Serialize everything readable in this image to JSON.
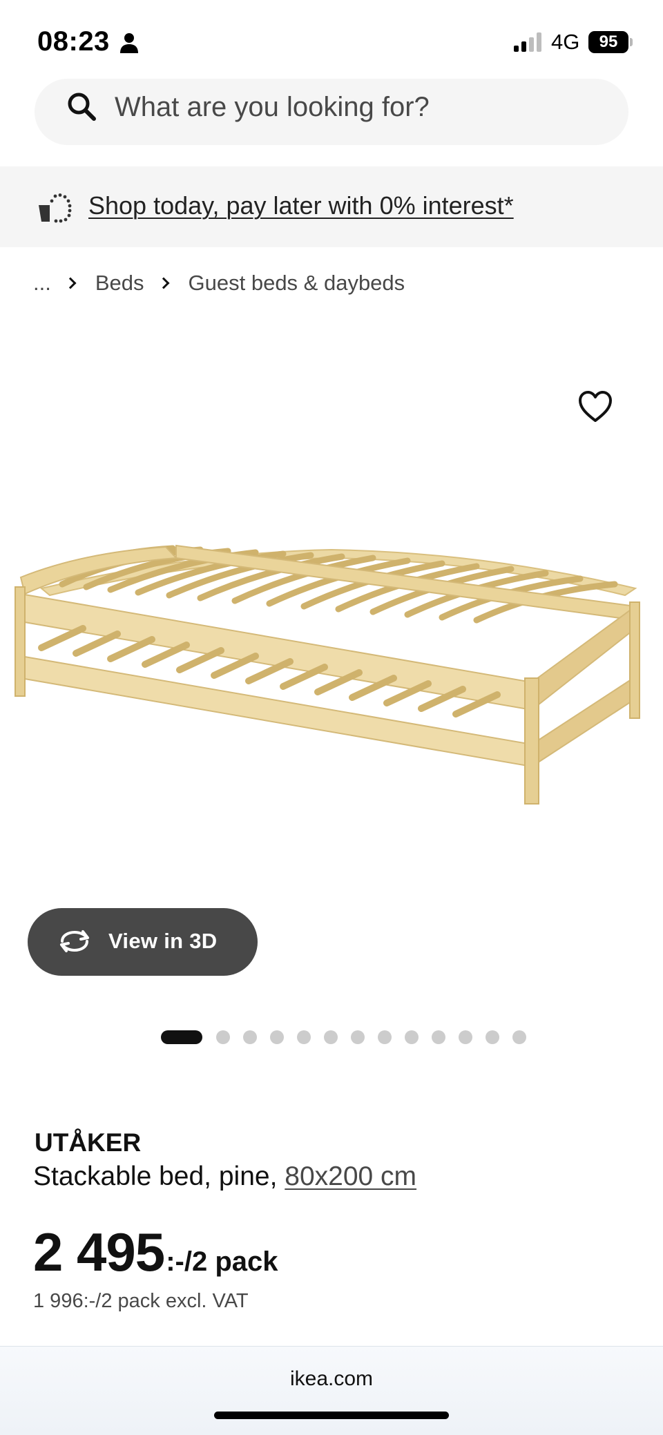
{
  "status_bar": {
    "time": "08:23",
    "network": "4G",
    "battery": "95"
  },
  "search": {
    "placeholder": "What are you looking for?",
    "value": ""
  },
  "promo": {
    "text": "Shop today, pay later with 0% interest*"
  },
  "breadcrumb": {
    "ellipsis": "...",
    "items": [
      "Beds",
      "Guest beds & daybeds"
    ]
  },
  "gallery": {
    "view3d_label": "View in 3D",
    "total_images": 13,
    "active_index": 0
  },
  "product": {
    "name": "UTÅKER",
    "description_prefix": "Stackable bed, pine, ",
    "size": "80x200 cm",
    "price_main": "2 495",
    "price_unit": ":-/2 pack",
    "price_excl_vat": "1 996:-/2 pack excl. VAT"
  },
  "browser": {
    "domain": "ikea.com"
  },
  "colors": {
    "accent_dark": "#111111",
    "button_gray": "#484848",
    "surface_gray": "#f5f5f5",
    "wood": "#e8d6a0"
  }
}
